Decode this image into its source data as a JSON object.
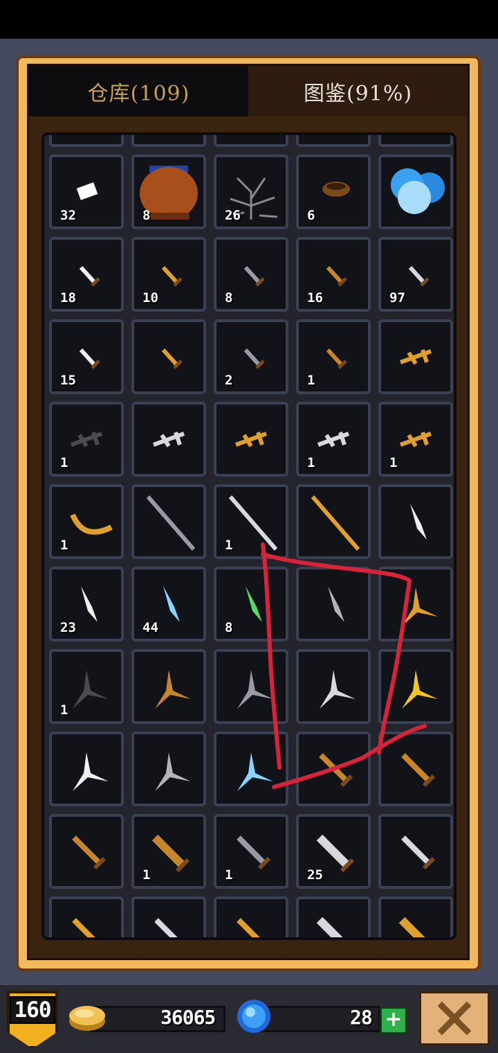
{
  "tabs": {
    "warehouse_label": "仓库(109)",
    "codex_label": "图鉴(91%)"
  },
  "grid": {
    "rows": [
      [
        {
          "icon": "item-partial",
          "count": ""
        },
        {
          "icon": "item-partial",
          "count": ""
        },
        {
          "icon": "item-partial",
          "count": ""
        },
        {
          "icon": "item-partial",
          "count": ""
        },
        {
          "icon": "item-partial",
          "count": ""
        }
      ],
      [
        {
          "icon": "cloth-scrap-icon",
          "count": "32"
        },
        {
          "icon": "clay-pot-icon",
          "count": "8"
        },
        {
          "icon": "dry-branches-icon",
          "count": "26"
        },
        {
          "icon": "bird-nest-icon",
          "count": "6"
        },
        {
          "icon": "blue-slime-icon",
          "count": ""
        }
      ],
      [
        {
          "icon": "bone-dagger-icon",
          "count": "18"
        },
        {
          "icon": "gold-dagger-icon",
          "count": "10"
        },
        {
          "icon": "iron-dagger-icon",
          "count": "8"
        },
        {
          "icon": "bronze-dagger-icon",
          "count": "16"
        },
        {
          "icon": "steel-dagger-icon",
          "count": "97"
        }
      ],
      [
        {
          "icon": "short-dagger-white-icon",
          "count": "15"
        },
        {
          "icon": "short-dagger-gold-icon",
          "count": ""
        },
        {
          "icon": "short-dagger-iron-icon",
          "count": "2"
        },
        {
          "icon": "short-dagger-bronze-icon",
          "count": "1"
        },
        {
          "icon": "gold-sai-icon",
          "count": ""
        }
      ],
      [
        {
          "icon": "dark-sai-icon",
          "count": "1"
        },
        {
          "icon": "silver-sai-icon",
          "count": ""
        },
        {
          "icon": "gold-sai-icon",
          "count": ""
        },
        {
          "icon": "silver-sai-icon",
          "count": "1"
        },
        {
          "icon": "gold-sai-icon",
          "count": "1"
        }
      ],
      [
        {
          "icon": "gold-sickle-icon",
          "count": "1"
        },
        {
          "icon": "iron-spear-icon",
          "count": ""
        },
        {
          "icon": "long-spear-icon",
          "count": "1"
        },
        {
          "icon": "golden-staff-icon",
          "count": ""
        },
        {
          "icon": "white-blade-icon",
          "count": ""
        }
      ],
      [
        {
          "icon": "zigzag-blade-icon",
          "count": "23"
        },
        {
          "icon": "ice-shard-icon",
          "count": "44"
        },
        {
          "icon": "jade-shard-icon",
          "count": "8"
        },
        {
          "icon": "grey-claw-icon",
          "count": ""
        },
        {
          "icon": "gold-shuriken-icon",
          "count": ""
        }
      ],
      [
        {
          "icon": "dark-shuriken-icon",
          "count": "1"
        },
        {
          "icon": "bronze-shuriken-icon",
          "count": ""
        },
        {
          "icon": "iron-shuriken-icon",
          "count": ""
        },
        {
          "icon": "silver-shuriken-icon",
          "count": ""
        },
        {
          "icon": "yellow-shuriken-icon",
          "count": ""
        }
      ],
      [
        {
          "icon": "white-shuriken-icon",
          "count": ""
        },
        {
          "icon": "grey-shuriken-icon",
          "count": ""
        },
        {
          "icon": "ice-shuriken-icon",
          "count": ""
        },
        {
          "icon": "bronze-shortsword-icon",
          "count": ""
        },
        {
          "icon": "bronze-shortsword-icon",
          "count": ""
        }
      ],
      [
        {
          "icon": "wooden-sword-icon",
          "count": ""
        },
        {
          "icon": "wooden-broadsword-icon",
          "count": "1"
        },
        {
          "icon": "iron-sword-icon",
          "count": "1"
        },
        {
          "icon": "steel-broadsword-icon",
          "count": "25"
        },
        {
          "icon": "silver-sword-icon",
          "count": ""
        }
      ],
      [
        {
          "icon": "gold-sword-icon",
          "count": ""
        },
        {
          "icon": "silver-sword-icon",
          "count": ""
        },
        {
          "icon": "gold-sword-icon",
          "count": ""
        },
        {
          "icon": "steel-broadsword-icon",
          "count": ""
        },
        {
          "icon": "gold-broadsword-icon",
          "count": ""
        }
      ]
    ]
  },
  "bottom_bar": {
    "level": "160",
    "coins": "36065",
    "gems": "28",
    "add_gems_label": "+",
    "close_icon": "close-x-icon"
  }
}
